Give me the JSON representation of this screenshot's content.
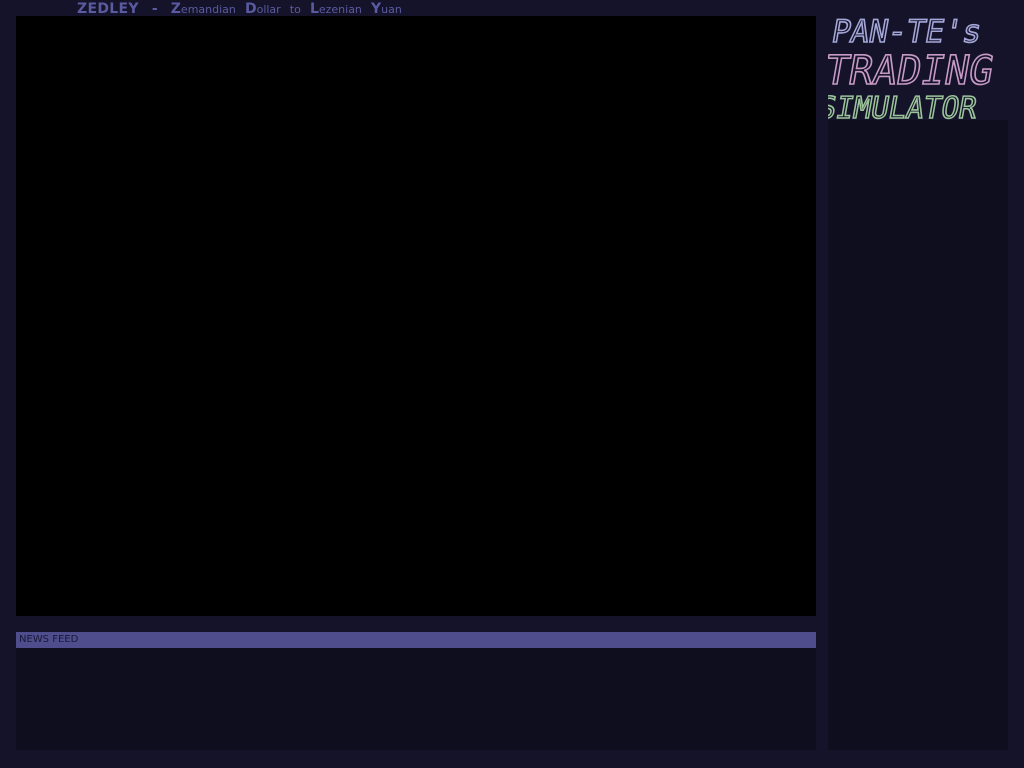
{
  "header": {
    "ticker": "ZEDLEY",
    "separator": "-",
    "pair": [
      {
        "cap": "Z",
        "rest": "emandian"
      },
      {
        "cap": "D",
        "rest": "ollar"
      },
      {
        "cap": "",
        "rest": "to"
      },
      {
        "cap": "L",
        "rest": "ezenian"
      },
      {
        "cap": "Y",
        "rest": "uan"
      }
    ]
  },
  "logo": {
    "line1": "PAN-TE's",
    "line2": "TRADING",
    "line3": "SIMULATOR",
    "colors": {
      "line1": "#a3a6d6",
      "line2": "#c79ac6",
      "line3": "#9bc49a"
    }
  },
  "news": {
    "title": "NEWS FEED",
    "items": []
  },
  "colors": {
    "background": "#15132a",
    "chart_bg": "#000000",
    "panel_bg": "#0f0e1f",
    "news_header_bg": "#4f4d8c",
    "title_text": "#5a5aa0"
  }
}
